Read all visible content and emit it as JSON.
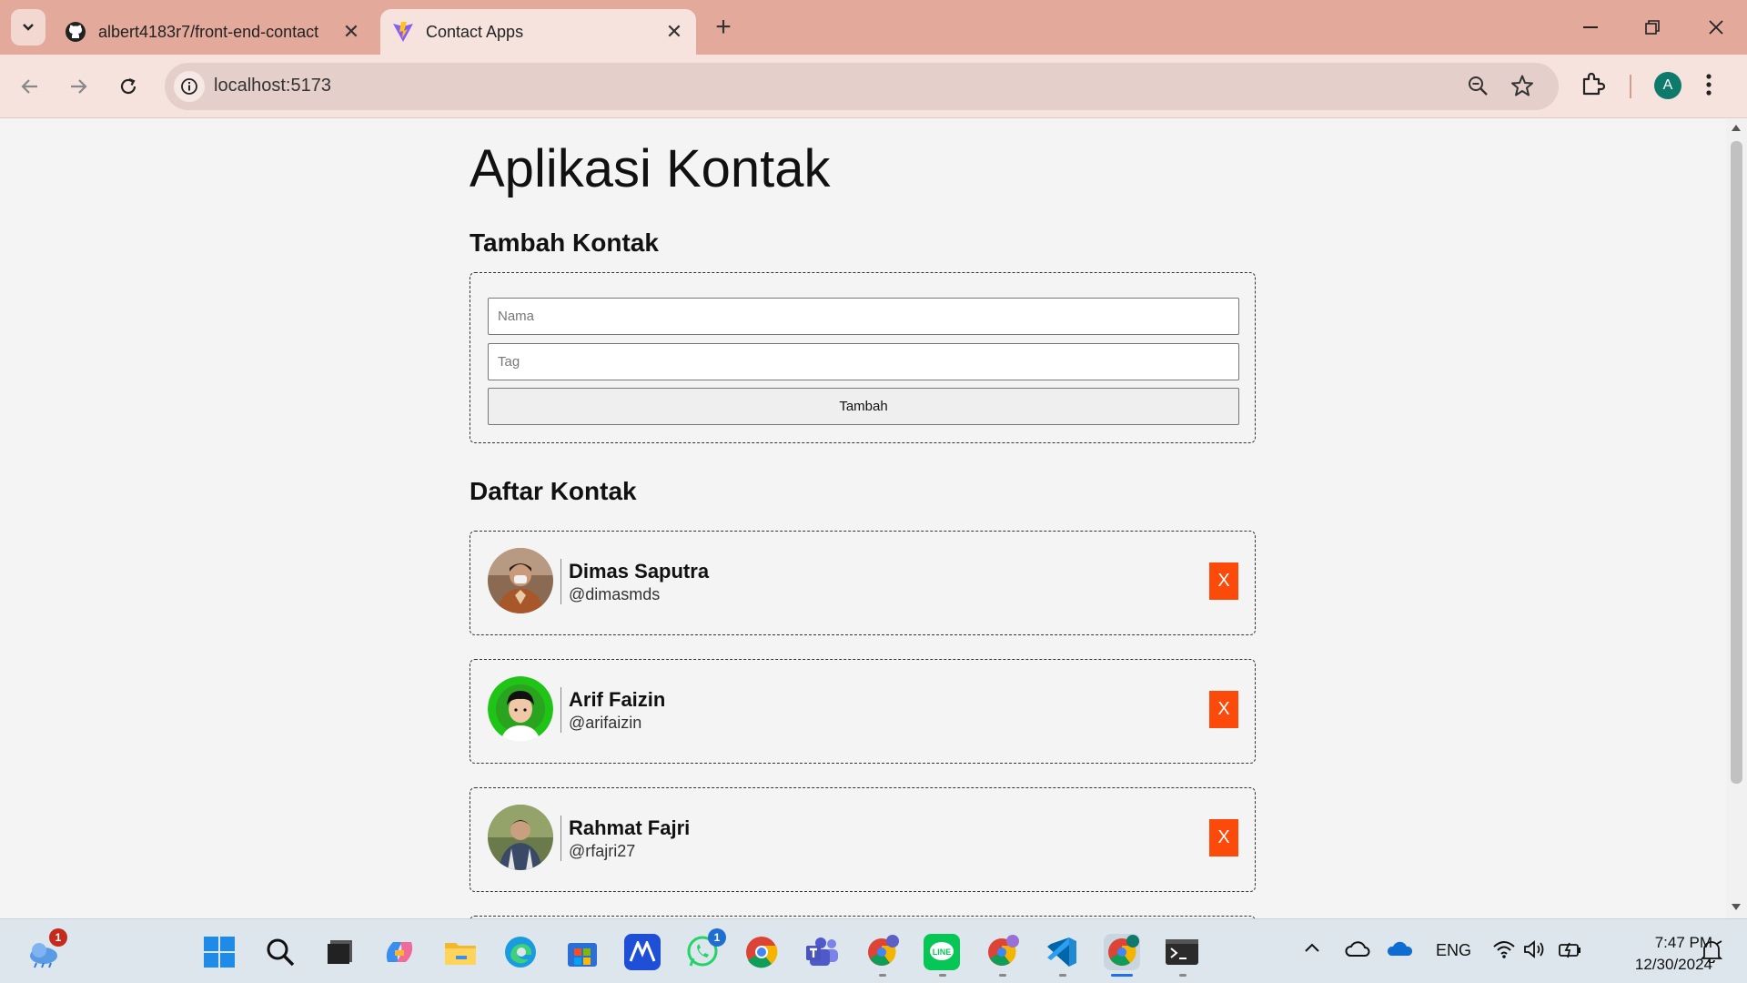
{
  "browser": {
    "tabs": [
      {
        "title": "albert4183r7/front-end-contact",
        "icon": "github-icon",
        "active": false
      },
      {
        "title": "Contact Apps",
        "icon": "vite-icon",
        "active": true
      }
    ],
    "address": "localhost:5173",
    "profile_initial": "A"
  },
  "app": {
    "title": "Aplikasi Kontak",
    "add_section_title": "Tambah Kontak",
    "name_placeholder": "Nama",
    "tag_placeholder": "Tag",
    "add_button": "Tambah",
    "list_section_title": "Daftar Kontak",
    "delete_label": "X",
    "contacts": [
      {
        "name": "Dimas Saputra",
        "tag": "@dimasmds"
      },
      {
        "name": "Arif Faizin",
        "tag": "@arifaizin"
      },
      {
        "name": "Rahmat Fajri",
        "tag": "@rfajri27"
      }
    ]
  },
  "taskbar": {
    "weather_badge": "1",
    "whatsapp_badge": "1",
    "language": "ENG",
    "time": "7:47 PM",
    "date": "12/30/2024"
  },
  "colors": {
    "tabstrip": "#e3a99b",
    "toolbar": "#f6e3de",
    "delete_button": "#fc4a0a",
    "page_bg": "#f4f4f4"
  }
}
